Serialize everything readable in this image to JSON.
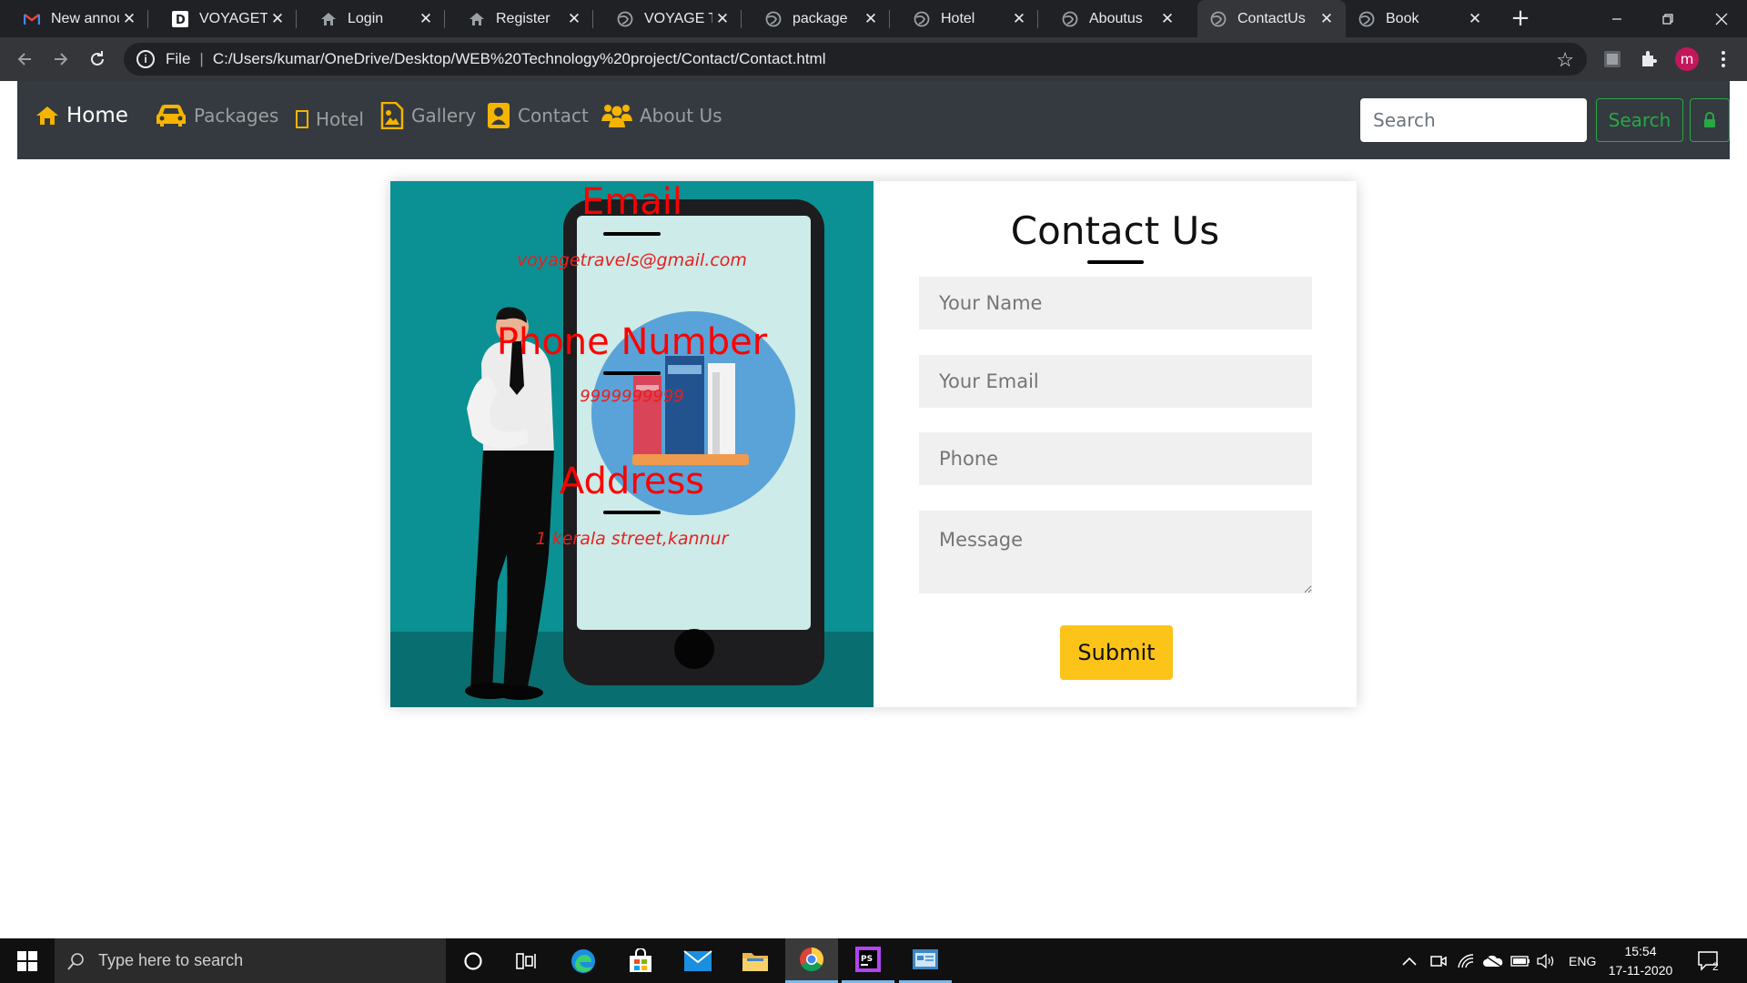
{
  "browser": {
    "tabs": [
      {
        "title": "New announ",
        "icon": "gmail-icon",
        "active": false
      },
      {
        "title": "VOYAGETRA",
        "icon": "d-logo-icon",
        "active": false
      },
      {
        "title": "Login",
        "icon": "house-icon",
        "active": false
      },
      {
        "title": "Register",
        "icon": "house-icon",
        "active": false
      },
      {
        "title": "VOYAGE TR",
        "icon": "globe-icon",
        "active": false
      },
      {
        "title": "package",
        "icon": "globe-icon",
        "active": false
      },
      {
        "title": "Hotel",
        "icon": "globe-icon",
        "active": false
      },
      {
        "title": "Aboutus",
        "icon": "globe-icon",
        "active": false
      },
      {
        "title": "ContactUs",
        "icon": "globe-icon",
        "active": true
      },
      {
        "title": "Book",
        "icon": "globe-icon",
        "active": false
      }
    ],
    "close_glyph": "✕",
    "new_tab_glyph": "+",
    "address": {
      "scheme": "File",
      "url": "C:/Users/kumar/OneDrive/Desktop/WEB%20Technology%20project/Contact/Contact.html"
    },
    "profile_initial": "m"
  },
  "site_nav": {
    "home": "Home",
    "packages": "Packages",
    "hotel": "Hotel",
    "gallery": "Gallery",
    "contact": "Contact",
    "about": "About Us",
    "search_placeholder": "Search",
    "search_button": "Search",
    "accent_color": "#f4b400",
    "button_color": "#28a745"
  },
  "contact_info": {
    "email_title": "Email",
    "email_value": "voyagetravels@gmail.com",
    "phone_title": "Phone Number",
    "phone_value": "9999999999",
    "address_title": "Address",
    "address_value": "1 kerala street,kannur",
    "title_color": "#ff0000"
  },
  "contact_form": {
    "title": "Contact Us",
    "name_placeholder": "Your Name",
    "email_placeholder": "Your Email",
    "phone_placeholder": "Phone",
    "message_placeholder": "Message",
    "submit_label": "Submit",
    "submit_color": "#fcc419"
  },
  "taskbar": {
    "search_placeholder": "Type here to search",
    "language": "ENG",
    "time": "15:54",
    "date": "17-11-2020",
    "notification_count": "2",
    "apps": [
      "cortana-icon",
      "task-view-icon",
      "edge-icon",
      "store-icon",
      "mail-icon",
      "file-explorer-icon",
      "chrome-icon",
      "phpstorm-icon",
      "control-panel-icon"
    ]
  }
}
